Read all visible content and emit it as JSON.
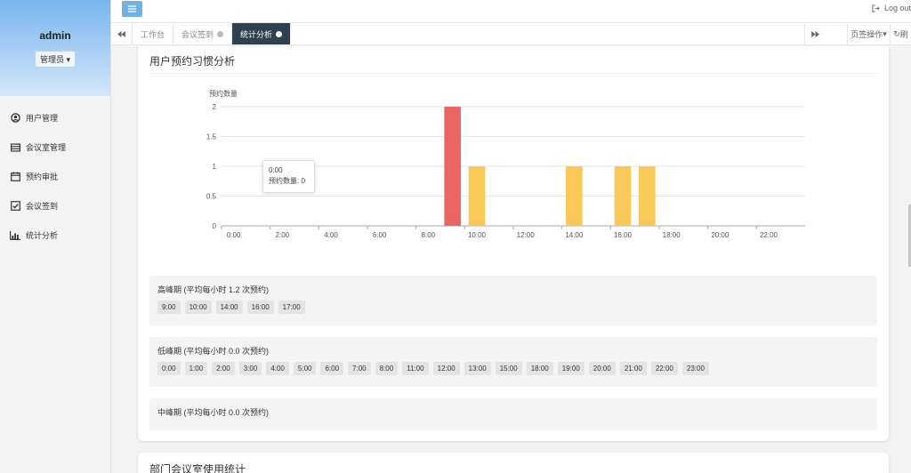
{
  "sidebar": {
    "user_name": "admin",
    "role": "管理员",
    "items": [
      {
        "label": "用户管理",
        "icon": "user-circle-icon"
      },
      {
        "label": "会议室管理",
        "icon": "list-icon"
      },
      {
        "label": "预约审批",
        "icon": "calendar-icon"
      },
      {
        "label": "会议签到",
        "icon": "check-square-icon"
      },
      {
        "label": "统计分析",
        "icon": "bar-chart-icon"
      }
    ]
  },
  "topbar": {
    "logout_label": "Log out"
  },
  "tabs": {
    "items": [
      {
        "label": "工作台",
        "closable": false
      },
      {
        "label": "会议签到",
        "closable": true
      },
      {
        "label": "统计分析",
        "closable": true,
        "active": true
      }
    ],
    "ops_label": "页签操作",
    "refresh_label": "刷"
  },
  "panel": {
    "title": "用户预约习惯分析",
    "tooltip": {
      "time": "0:00",
      "line": "预约数量: 0"
    }
  },
  "chart_data": {
    "type": "bar",
    "ylabel": "预约数量",
    "xlabel": "",
    "ylim": [
      0,
      2
    ],
    "yticks": [
      0,
      0.5,
      1,
      1.5,
      2
    ],
    "categories": [
      "0:00",
      "1:00",
      "2:00",
      "3:00",
      "4:00",
      "5:00",
      "6:00",
      "7:00",
      "8:00",
      "9:00",
      "10:00",
      "11:00",
      "12:00",
      "13:00",
      "14:00",
      "15:00",
      "16:00",
      "17:00",
      "18:00",
      "19:00",
      "20:00",
      "21:00",
      "22:00",
      "23:00"
    ],
    "xtick_labels": [
      "0:00",
      "2:00",
      "4:00",
      "6:00",
      "8:00",
      "10:00",
      "12:00",
      "14:00",
      "16:00",
      "18:00",
      "20:00",
      "22:00"
    ],
    "values": [
      0,
      0,
      0,
      0,
      0,
      0,
      0,
      0,
      0,
      2,
      1,
      0,
      0,
      0,
      1,
      0,
      1,
      1,
      0,
      0,
      0,
      0,
      0,
      0
    ],
    "colors": {
      "max": "#ec6565",
      "default": "#f9c859"
    }
  },
  "peaks": [
    {
      "title": "高峰期 (平均每小时 1.2 次预约)",
      "hours": [
        "9:00",
        "10:00",
        "14:00",
        "16:00",
        "17:00"
      ]
    },
    {
      "title": "低峰期 (平均每小时 0.0 次预约)",
      "hours": [
        "0:00",
        "1:00",
        "2:00",
        "3:00",
        "4:00",
        "5:00",
        "6:00",
        "7:00",
        "8:00",
        "11:00",
        "12:00",
        "13:00",
        "15:00",
        "18:00",
        "19:00",
        "20:00",
        "21:00",
        "22:00",
        "23:00"
      ]
    },
    {
      "title": "中峰期 (平均每小时 0.0 次预约)",
      "hours": []
    }
  ],
  "panel2": {
    "title": "部门会议室使用统计"
  }
}
